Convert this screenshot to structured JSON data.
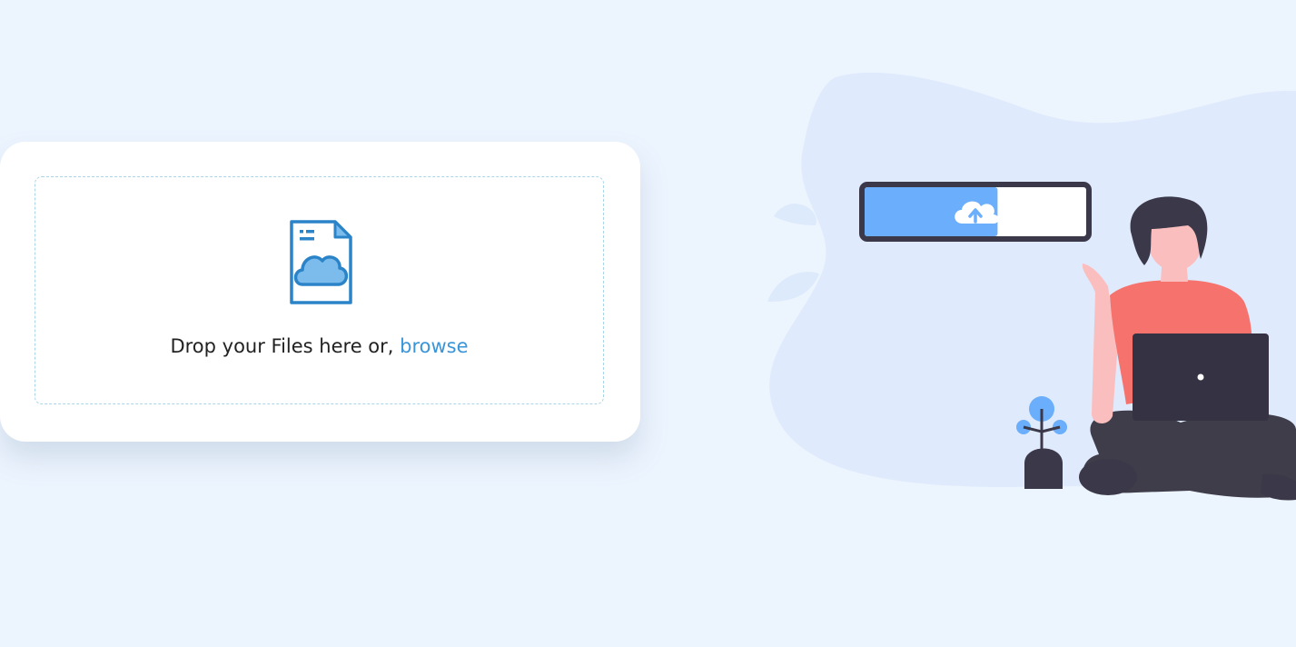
{
  "upload": {
    "prompt": "Drop your Files here or,",
    "browse_label": "browse"
  },
  "upload_progress": {
    "fraction": 0.6
  },
  "icons": {
    "file_icon": "cloud-file-icon",
    "upload_icon": "cloud-upload-icon"
  },
  "colors": {
    "background": "#ecf4fe",
    "accent": "#3a95d8",
    "progress_fill": "#6aaefc",
    "dark": "#3b3849",
    "shirt": "#f6736d"
  }
}
